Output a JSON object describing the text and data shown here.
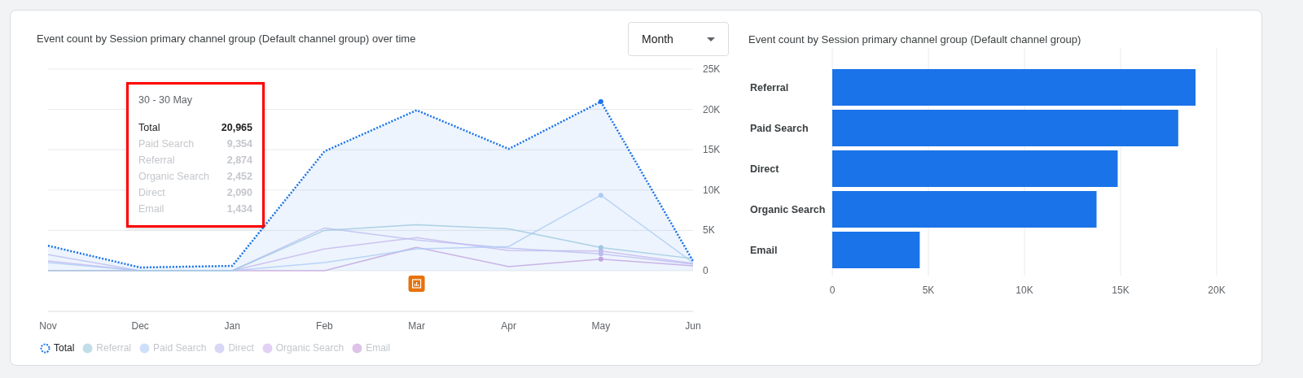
{
  "line_panel": {
    "title": "Event count by Session primary channel group (Default channel group) over time",
    "period_dropdown": {
      "value": "Month"
    },
    "chart_data": {
      "type": "line",
      "grid": true,
      "categories": [
        "Nov",
        "Dec",
        "Jan",
        "Feb",
        "Mar",
        "Apr",
        "May",
        "Jun"
      ],
      "ylim": [
        0,
        25000
      ],
      "yticks": [
        {
          "value": 0,
          "label": "0"
        },
        {
          "value": 5000,
          "label": "5K"
        },
        {
          "value": 10000,
          "label": "10K"
        },
        {
          "value": 15000,
          "label": "15K"
        },
        {
          "value": 20000,
          "label": "20K"
        },
        {
          "value": 25000,
          "label": "25K"
        }
      ],
      "series": [
        {
          "name": "Total",
          "type": "area",
          "color": "#1a73e8",
          "line_style": "dotted",
          "values": [
            3100,
            400,
            600,
            14800,
            19900,
            15100,
            20965,
            1200
          ]
        },
        {
          "name": "Referral",
          "type": "line",
          "color": "#a8cfe0",
          "line_style": "solid",
          "values": [
            0,
            0,
            0,
            5000,
            5700,
            5200,
            2874,
            1500
          ]
        },
        {
          "name": "Paid Search",
          "type": "line",
          "color": "#b9d3f7",
          "line_style": "solid",
          "values": [
            1000,
            0,
            0,
            1000,
            2700,
            3000,
            9354,
            1000
          ]
        },
        {
          "name": "Direct",
          "type": "line",
          "color": "#c9c4f2",
          "line_style": "solid",
          "values": [
            2000,
            0,
            0,
            5300,
            3800,
            2800,
            2090,
            800
          ]
        },
        {
          "name": "Organic Search",
          "type": "line",
          "color": "#d6bdef",
          "line_style": "solid",
          "values": [
            1200,
            0,
            0,
            2700,
            4100,
            2500,
            2452,
            900
          ]
        },
        {
          "name": "Email",
          "type": "line",
          "color": "#cfa9e0",
          "line_style": "solid",
          "values": [
            0,
            0,
            0,
            0,
            2900,
            500,
            1434,
            600
          ]
        }
      ]
    },
    "legend": [
      {
        "selected": true
      },
      {
        "selected": false
      },
      {
        "selected": false
      },
      {
        "selected": false
      },
      {
        "selected": false
      },
      {
        "selected": false
      }
    ],
    "tooltip": {
      "date": "30 - 30 May",
      "rows": [
        {
          "label": "Total",
          "value": "20,965",
          "emphasized": true
        },
        {
          "label": "Paid Search",
          "value": "9,354",
          "emphasized": false
        },
        {
          "label": "Referral",
          "value": "2,874",
          "emphasized": false
        },
        {
          "label": "Organic Search",
          "value": "2,452",
          "emphasized": false
        },
        {
          "label": "Direct",
          "value": "2,090",
          "emphasized": false
        },
        {
          "label": "Email",
          "value": "1,434",
          "emphasized": false
        }
      ]
    }
  },
  "bar_panel": {
    "title": "Event count by Session primary channel group (Default channel group)",
    "chart_data": {
      "type": "bar",
      "orientation": "horizontal",
      "grid": true,
      "categories": [
        "Referral",
        "Paid Search",
        "Direct",
        "Organic Search",
        "Email"
      ],
      "xlim": [
        0,
        20000
      ],
      "xticks": [
        {
          "value": 0,
          "label": "0"
        },
        {
          "value": 5000,
          "label": "5K"
        },
        {
          "value": 10000,
          "label": "10K"
        },
        {
          "value": 15000,
          "label": "15K"
        },
        {
          "value": 20000,
          "label": "20K"
        }
      ],
      "series": [
        {
          "color": "#1a73e8",
          "values": [
            18900,
            18000,
            14850,
            13750,
            4550
          ]
        }
      ]
    }
  }
}
